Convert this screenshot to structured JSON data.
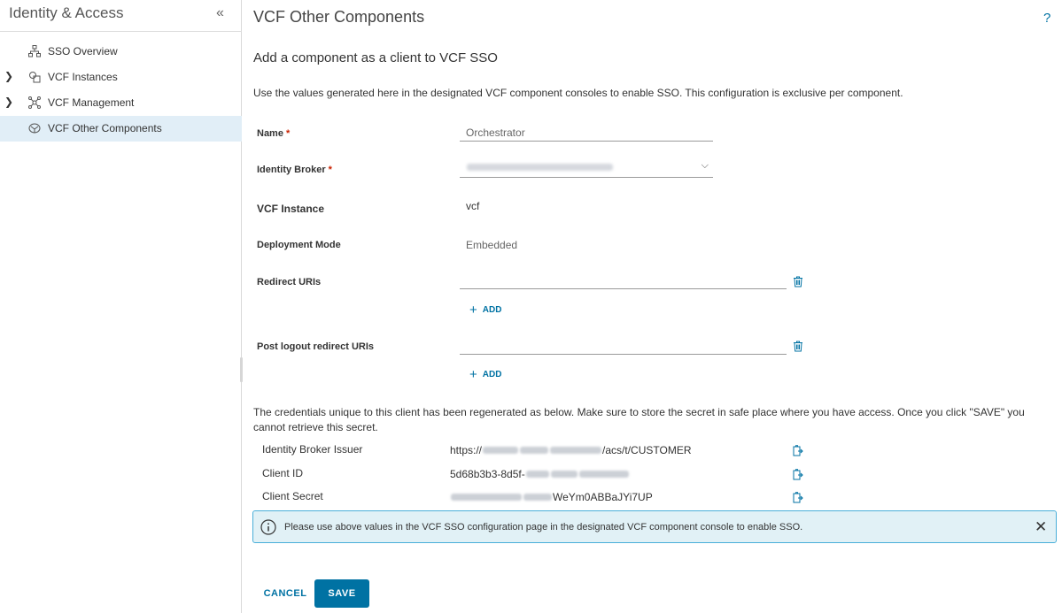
{
  "sidebar": {
    "title": "Identity & Access",
    "collapse_icon": "double-chevron-left-icon",
    "items": [
      {
        "label": "SSO Overview",
        "icon": "sitemap-icon",
        "expandable": false,
        "active": false
      },
      {
        "label": "VCF Instances",
        "icon": "instances-icon",
        "expandable": true,
        "active": false
      },
      {
        "label": "VCF Management",
        "icon": "cluster-icon",
        "expandable": true,
        "active": false
      },
      {
        "label": "VCF Other Components",
        "icon": "components-icon",
        "expandable": false,
        "active": true
      }
    ]
  },
  "page": {
    "title": "VCF Other Components",
    "help": "?"
  },
  "form": {
    "heading": "Add a component as a client to VCF SSO",
    "intro": "Use the values generated here in the designated VCF component consoles to enable SSO. This configuration is exclusive per component.",
    "name_label": "Name",
    "name_value": "Orchestrator",
    "required_mark": "*",
    "identity_broker_label": "Identity Broker",
    "vcf_instance_label": "VCF Instance",
    "vcf_instance_value": "vcf",
    "deployment_mode_label": "Deployment Mode",
    "deployment_mode_value": "Embedded",
    "redirect_uris_label": "Redirect URIs",
    "redirect_uris_value": "",
    "post_logout_label": "Post logout redirect URIs",
    "post_logout_value": "",
    "add_label": "ADD"
  },
  "credentials": {
    "note": "The credentials unique to this client has been regenerated as below. Make sure to store the secret in safe place where you have access. Once you click \"SAVE\" you cannot retrieve this secret.",
    "issuer_label": "Identity Broker Issuer",
    "issuer_prefix": "https://",
    "issuer_suffix": "/acs/t/CUSTOMER",
    "client_id_label": "Client ID",
    "client_id_prefix": "5d68b3b3-8d5f-",
    "client_secret_label": "Client Secret",
    "client_secret_suffix": "WeYm0ABBaJYi7UP"
  },
  "alert": {
    "text": "Please use above values in the VCF SSO configuration page in the designated VCF component console to enable SSO.",
    "close": "✕"
  },
  "actions": {
    "cancel_label": "CANCEL",
    "save_label": "SAVE"
  },
  "colors": {
    "accent": "#0072a3",
    "active_nav_bg": "#e1eef7",
    "alert_border": "#49afd9",
    "alert_bg": "#e1f1f6",
    "required": "#c92100"
  }
}
